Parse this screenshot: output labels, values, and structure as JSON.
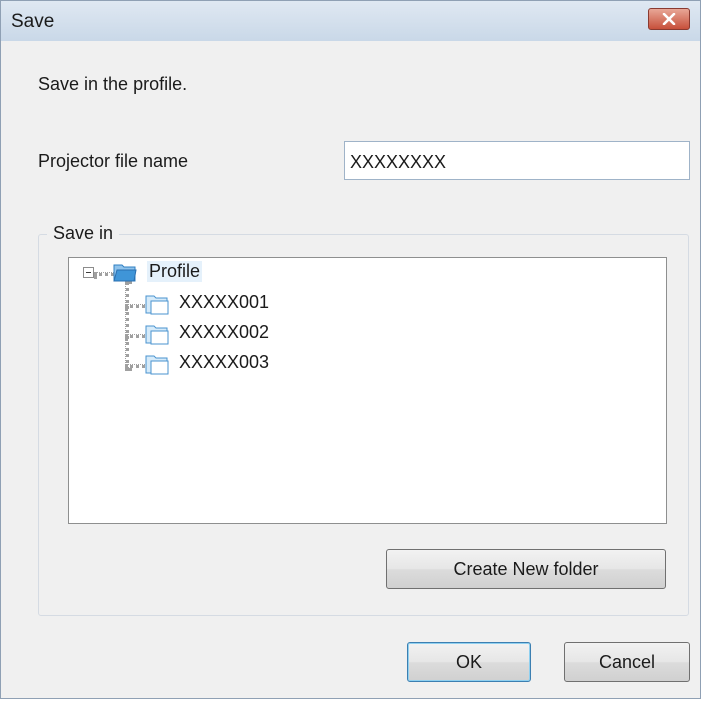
{
  "dialog": {
    "title": "Save",
    "close_icon": "close-icon",
    "instruction": "Save in the profile."
  },
  "filename": {
    "label": "Projector file name",
    "value": "XXXXXXXX"
  },
  "save_in": {
    "label": "Save in",
    "tree": {
      "root": {
        "label": "Profile",
        "icon": "folder-open-icon",
        "expanded": true
      },
      "children": [
        {
          "label": "XXXXX001",
          "icon": "folder-icon"
        },
        {
          "label": "XXXXX002",
          "icon": "folder-icon"
        },
        {
          "label": "XXXXX003",
          "icon": "folder-icon"
        }
      ]
    },
    "create_folder_label": "Create New folder"
  },
  "buttons": {
    "ok_label": "OK",
    "cancel_label": "Cancel"
  },
  "colors": {
    "close_button": "#c7503b",
    "selection_highlight": "#e5f1fb",
    "folder": "#3f95d8"
  }
}
